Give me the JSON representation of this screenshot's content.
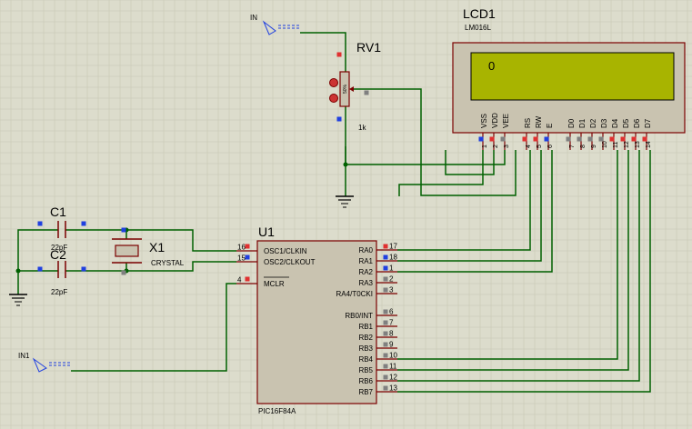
{
  "lcd": {
    "ref": "LCD1",
    "model": "LM016L",
    "display_char": "0",
    "pins": [
      {
        "name": "VSS",
        "num": "1"
      },
      {
        "name": "VDD",
        "num": "2"
      },
      {
        "name": "VEE",
        "num": "3"
      },
      {
        "name": "RS",
        "num": "4"
      },
      {
        "name": "RW",
        "num": "5"
      },
      {
        "name": "E",
        "num": "6"
      },
      {
        "name": "D0",
        "num": "7"
      },
      {
        "name": "D1",
        "num": "8"
      },
      {
        "name": "D2",
        "num": "9"
      },
      {
        "name": "D3",
        "num": "10"
      },
      {
        "name": "D4",
        "num": "11"
      },
      {
        "name": "D5",
        "num": "12"
      },
      {
        "name": "D6",
        "num": "13"
      },
      {
        "name": "D7",
        "num": "14"
      }
    ],
    "lcd_color": "#a8b400"
  },
  "pot": {
    "ref": "RV1",
    "value": "1k",
    "percent": "50%"
  },
  "crystal": {
    "ref": "X1",
    "label": "CRYSTAL"
  },
  "caps": [
    {
      "ref": "C1",
      "value": "22pF"
    },
    {
      "ref": "C2",
      "value": "22pF"
    }
  ],
  "mcu": {
    "ref": "U1",
    "part": "PIC16F84A",
    "left_pins": [
      {
        "name": "OSC1/CLKIN",
        "num": "16"
      },
      {
        "name": "OSC2/CLKOUT",
        "num": "15"
      },
      {
        "name": "MCLR",
        "num": "4"
      }
    ],
    "right_pins": [
      {
        "name": "RA0",
        "num": "17"
      },
      {
        "name": "RA1",
        "num": "18"
      },
      {
        "name": "RA2",
        "num": "1"
      },
      {
        "name": "RA3",
        "num": "2"
      },
      {
        "name": "RA4/T0CKI",
        "num": "3"
      },
      {
        "name": "RB0/INT",
        "num": "6"
      },
      {
        "name": "RB1",
        "num": "7"
      },
      {
        "name": "RB2",
        "num": "8"
      },
      {
        "name": "RB3",
        "num": "9"
      },
      {
        "name": "RB4",
        "num": "10"
      },
      {
        "name": "RB5",
        "num": "11"
      },
      {
        "name": "RB6",
        "num": "12"
      },
      {
        "name": "RB7",
        "num": "13"
      }
    ]
  },
  "terminals": [
    {
      "label": "IN"
    },
    {
      "label": "IN1"
    }
  ],
  "colors": {
    "background": "#dcdccc",
    "grid": "#c6c6b4",
    "wire": "#006000",
    "component_outline": "#7b0000",
    "chip_fill": "#c9c3b0",
    "pin_red": "#e03030",
    "pin_blue": "#2040e0",
    "pin_gray": "#808080"
  }
}
